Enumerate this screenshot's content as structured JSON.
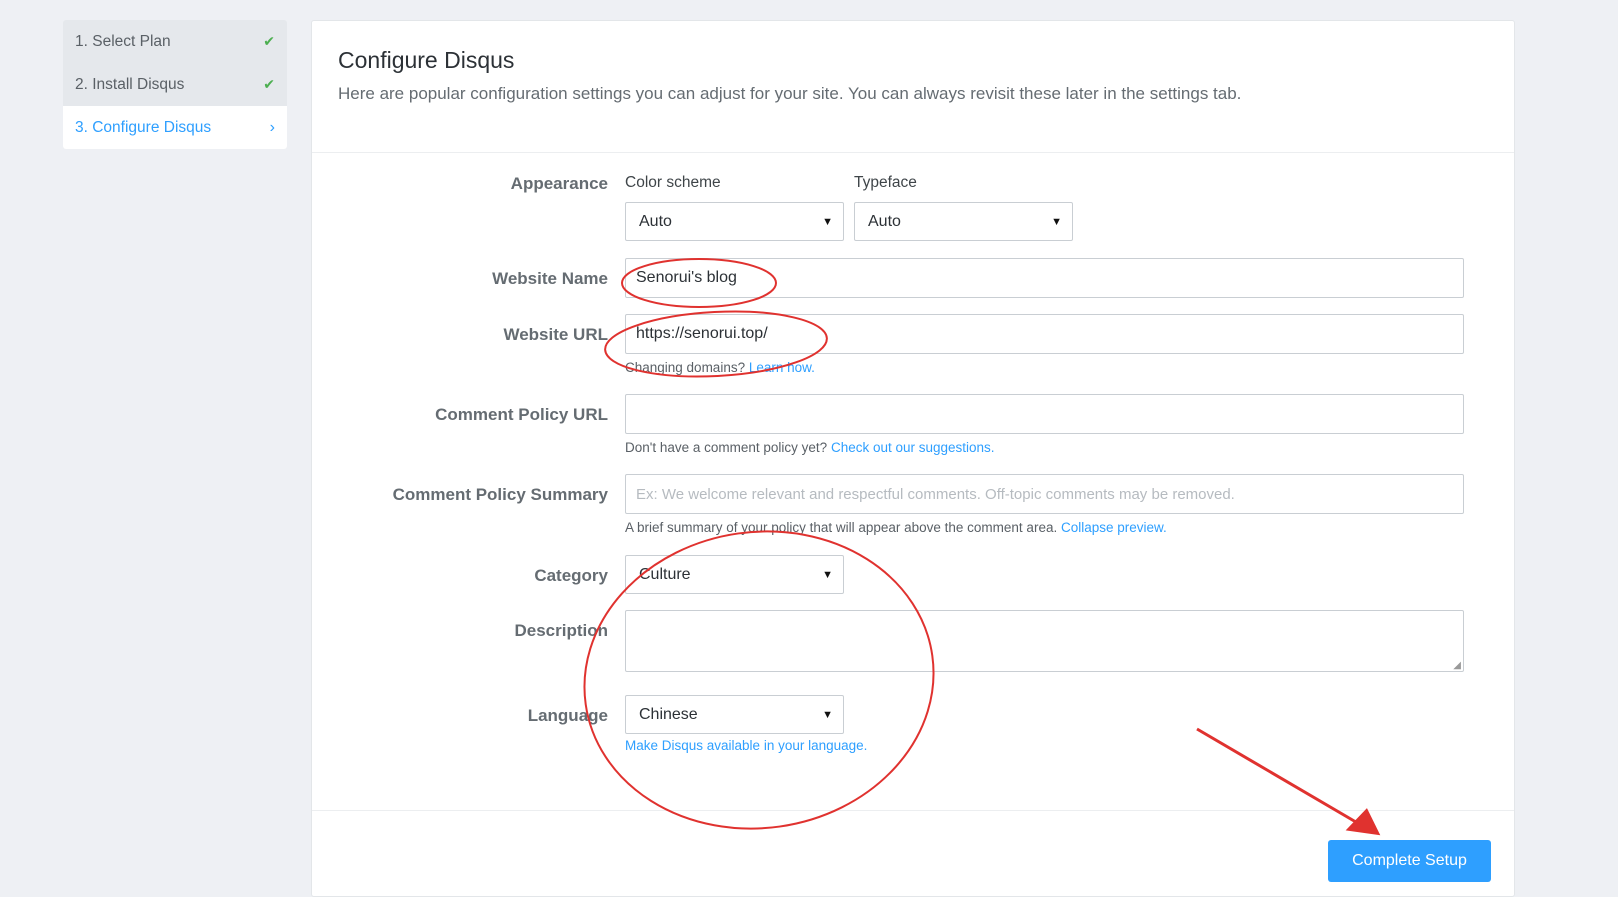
{
  "steps": [
    {
      "label": "1. Select Plan",
      "icon": "check-icon"
    },
    {
      "label": "2. Install Disqus",
      "icon": "check-icon"
    },
    {
      "label": "3. Configure Disqus",
      "icon": "chevron-right-icon"
    }
  ],
  "header": {
    "title": "Configure Disqus",
    "subtitle": "Here are popular configuration settings you can adjust for your site. You can always revisit these later in the settings tab."
  },
  "form": {
    "appearance": {
      "label": "Appearance",
      "color_scheme_label": "Color scheme",
      "color_scheme_value": "Auto",
      "typeface_label": "Typeface",
      "typeface_value": "Auto"
    },
    "website_name": {
      "label": "Website Name",
      "value": "Senorui's blog"
    },
    "website_url": {
      "label": "Website URL",
      "value": "https://senorui.top/",
      "help_text": "Changing domains?",
      "help_link": "Learn how."
    },
    "comment_policy_url": {
      "label": "Comment Policy URL",
      "value": "",
      "help_text": "Don't have a comment policy yet?",
      "help_link": "Check out our suggestions."
    },
    "comment_policy_summary": {
      "label": "Comment Policy Summary",
      "placeholder": "Ex: We welcome relevant and respectful comments. Off-topic comments may be removed.",
      "help_text": "A brief summary of your policy that will appear above the comment area.",
      "help_link": "Collapse preview."
    },
    "category": {
      "label": "Category",
      "value": "Culture"
    },
    "description": {
      "label": "Description",
      "value": ""
    },
    "language": {
      "label": "Language",
      "value": "Chinese",
      "help_link": "Make Disqus available in your language."
    }
  },
  "footer": {
    "submit_label": "Complete Setup"
  },
  "annotation_color": "#e0322f",
  "accent_color": "#2e9fff"
}
